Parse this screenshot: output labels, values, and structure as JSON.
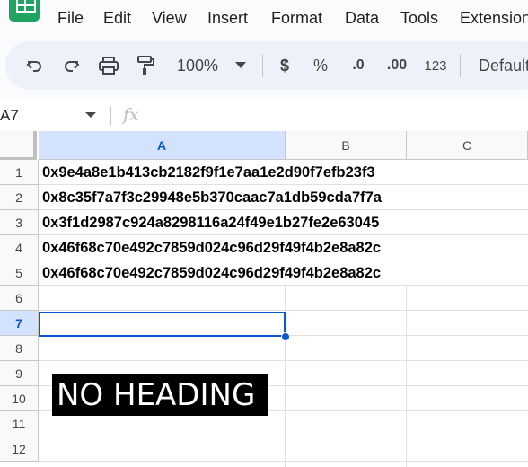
{
  "app": {
    "name": "Google Sheets",
    "accent": "#1ea362"
  },
  "menu": [
    "File",
    "Edit",
    "View",
    "Insert",
    "Format",
    "Data",
    "Tools",
    "Extensions"
  ],
  "toolbar": {
    "zoom": "100%",
    "currency": "$",
    "percent": "%",
    "decrease_decimal": ".0",
    "increase_decimal": ".00",
    "number_format": "123",
    "font": "Default"
  },
  "formula_bar": {
    "name_box": "A7",
    "fx": "fx",
    "value": ""
  },
  "columns": [
    "A",
    "B",
    "C"
  ],
  "selected_column": "A",
  "rows": [
    "1",
    "2",
    "3",
    "4",
    "5",
    "6",
    "7",
    "8",
    "9",
    "10",
    "11",
    "12"
  ],
  "selected_row": "7",
  "cells": {
    "A1": "0x9e4a8e1b413cb2182f9f1e7aa1e2d90f7efb23f3",
    "A2": "0x8c35f7a7f3c29948e5b370caac7a1db59cda7f7a",
    "A3": "0x3f1d2987c924a8298116a24f49e1b27fe2e63045",
    "A4": "0x46f68c70e492c7859d024c96d29f49f4b2e8a82c",
    "A5": "0x46f68c70e492c7859d024c96d29f49f4b2e8a82c"
  },
  "overlay_image": {
    "text": "NO HEADING"
  }
}
